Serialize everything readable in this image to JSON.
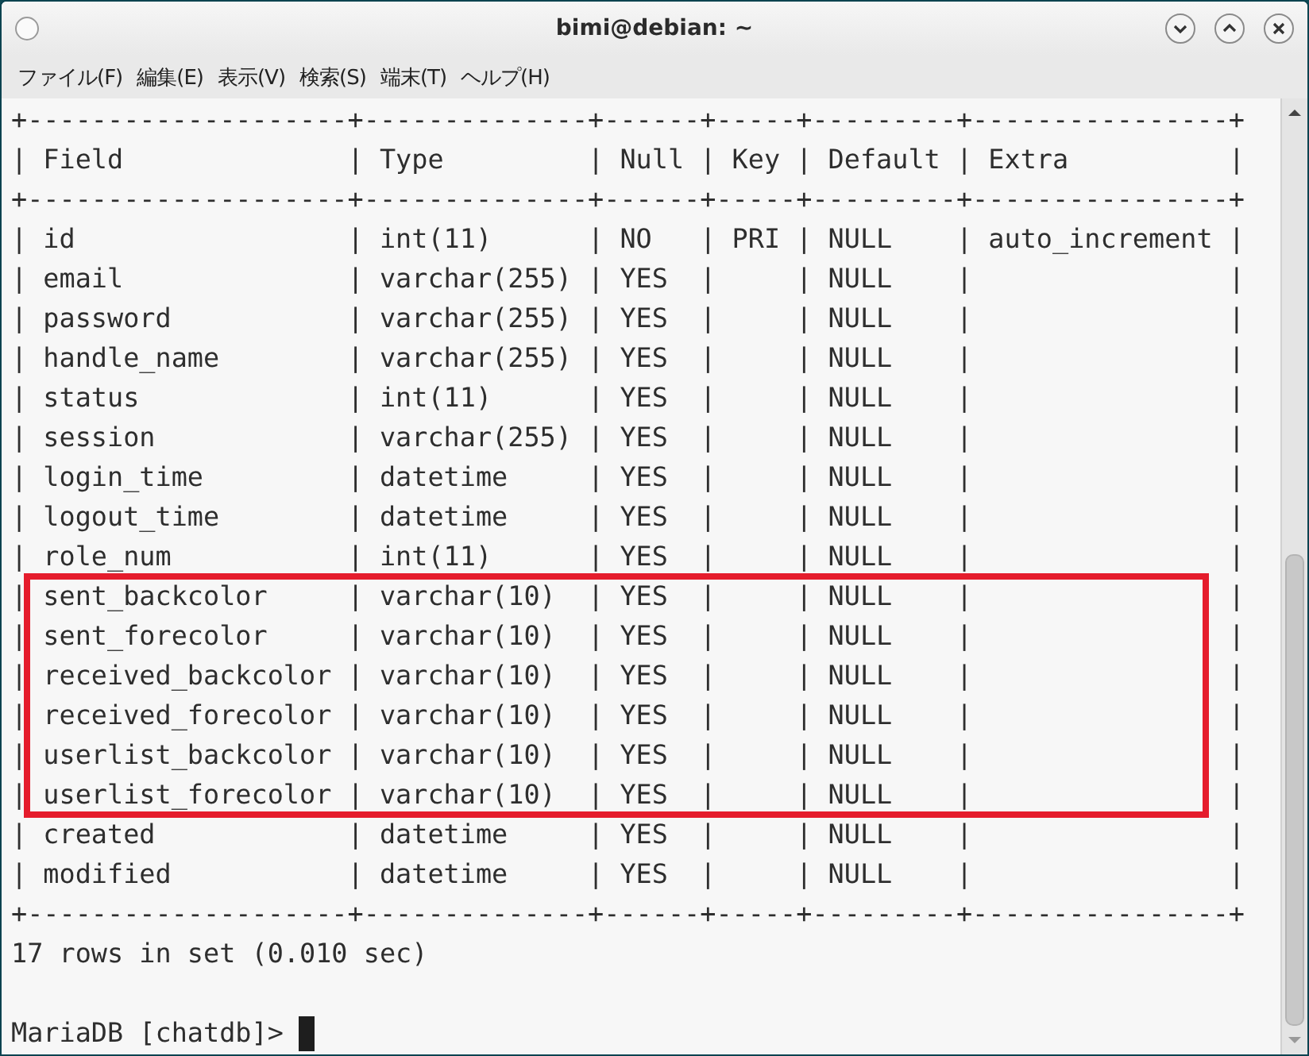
{
  "window": {
    "title": "bimi@debian: ~"
  },
  "menu": [
    "ファイル(F)",
    "編集(E)",
    "表示(V)",
    "検索(S)",
    "端末(T)",
    "ヘルプ(H)"
  ],
  "terminal": {
    "lines": [
      {
        "text": "+--------------------+--------------+------+-----+---------+----------------+",
        "highlighted": false
      },
      {
        "text": "| Field              | Type         | Null | Key | Default | Extra          |",
        "highlighted": false
      },
      {
        "text": "+--------------------+--------------+------+-----+---------+----------------+",
        "highlighted": false
      },
      {
        "text": "| id                 | int(11)      | NO   | PRI | NULL    | auto_increment |",
        "highlighted": false
      },
      {
        "text": "| email              | varchar(255) | YES  |     | NULL    |                |",
        "highlighted": false
      },
      {
        "text": "| password           | varchar(255) | YES  |     | NULL    |                |",
        "highlighted": false
      },
      {
        "text": "| handle_name        | varchar(255) | YES  |     | NULL    |                |",
        "highlighted": false
      },
      {
        "text": "| status             | int(11)      | YES  |     | NULL    |                |",
        "highlighted": false
      },
      {
        "text": "| session            | varchar(255) | YES  |     | NULL    |                |",
        "highlighted": false
      },
      {
        "text": "| login_time         | datetime     | YES  |     | NULL    |                |",
        "highlighted": false
      },
      {
        "text": "| logout_time        | datetime     | YES  |     | NULL    |                |",
        "highlighted": false
      },
      {
        "text": "| role_num           | int(11)      | YES  |     | NULL    |                |",
        "highlighted": false
      },
      {
        "text": "| sent_backcolor     | varchar(10)  | YES  |     | NULL    |                |",
        "highlighted": true
      },
      {
        "text": "| sent_forecolor     | varchar(10)  | YES  |     | NULL    |                |",
        "highlighted": true
      },
      {
        "text": "| received_backcolor | varchar(10)  | YES  |     | NULL    |                |",
        "highlighted": true
      },
      {
        "text": "| received_forecolor | varchar(10)  | YES  |     | NULL    |                |",
        "highlighted": true
      },
      {
        "text": "| userlist_backcolor | varchar(10)  | YES  |     | NULL    |                |",
        "highlighted": true
      },
      {
        "text": "| userlist_forecolor | varchar(10)  | YES  |     | NULL    |                |",
        "highlighted": true
      },
      {
        "text": "| created            | datetime     | YES  |     | NULL    |                |",
        "highlighted": false
      },
      {
        "text": "| modified           | datetime     | YES  |     | NULL    |                |",
        "highlighted": false
      },
      {
        "text": "+--------------------+--------------+------+-----+---------+----------------+",
        "highlighted": false
      },
      {
        "text": "17 rows in set (0.010 sec)",
        "highlighted": false
      }
    ],
    "prompt": "MariaDB [chatdb]>"
  }
}
